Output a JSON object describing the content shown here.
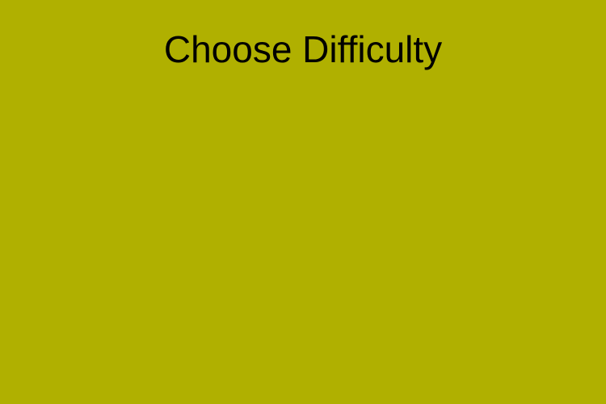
{
  "screen": {
    "title": "Choose Difficulty",
    "background_color": "#b0b000",
    "text_color": "#000000"
  }
}
